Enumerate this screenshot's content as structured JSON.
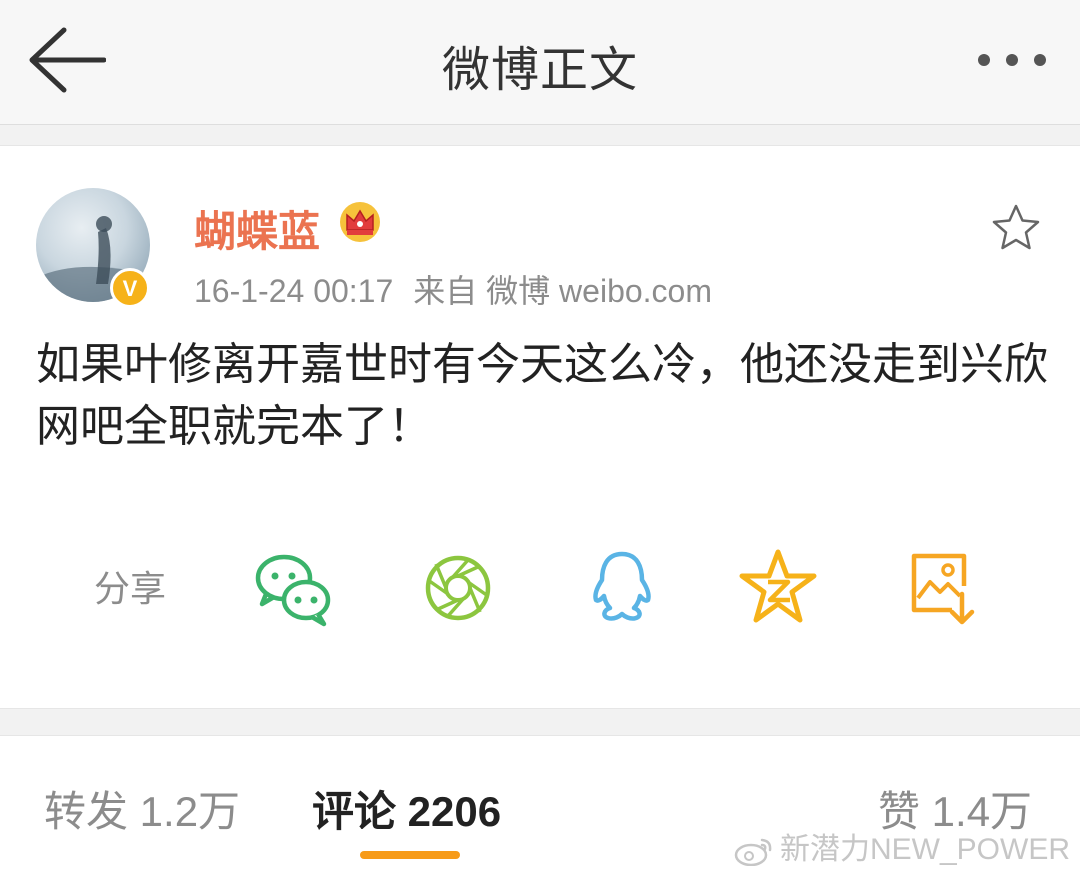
{
  "header": {
    "title": "微博正文",
    "back_icon": "arrow-left-icon",
    "more_icon": "ellipsis-icon"
  },
  "post": {
    "author": "蝴蝶蓝",
    "author_badge_icon": "crown-icon",
    "verified_icon": "verified-v-icon",
    "verified_letter": "V",
    "timestamp": "16-1-24 00:17",
    "source": "来自 微博 weibo.com",
    "favorite_icon": "star-outline-icon",
    "text": "如果叶修离开嘉世时有今天这么冷，他还没走到兴欣网吧全职就完本了！",
    "name_color": "#eb7350"
  },
  "share": {
    "label": "分享",
    "targets": [
      {
        "name": "wechat-icon",
        "color": "#3bb36b"
      },
      {
        "name": "moments-icon",
        "color": "#8cc63f"
      },
      {
        "name": "qq-icon",
        "color": "#5ab4e5"
      },
      {
        "name": "qzone-icon",
        "color": "#f6b219"
      },
      {
        "name": "save-image-icon",
        "color": "#f6a623"
      }
    ]
  },
  "stats": {
    "reposts": "转发 1.2万",
    "comments": "评论 2206",
    "likes": "赞 1.4万",
    "active_tab": "comments",
    "accent": "#f79b19"
  },
  "watermark": {
    "text": "新潜力NEW_POWER",
    "icon": "weibo-logo-icon"
  }
}
